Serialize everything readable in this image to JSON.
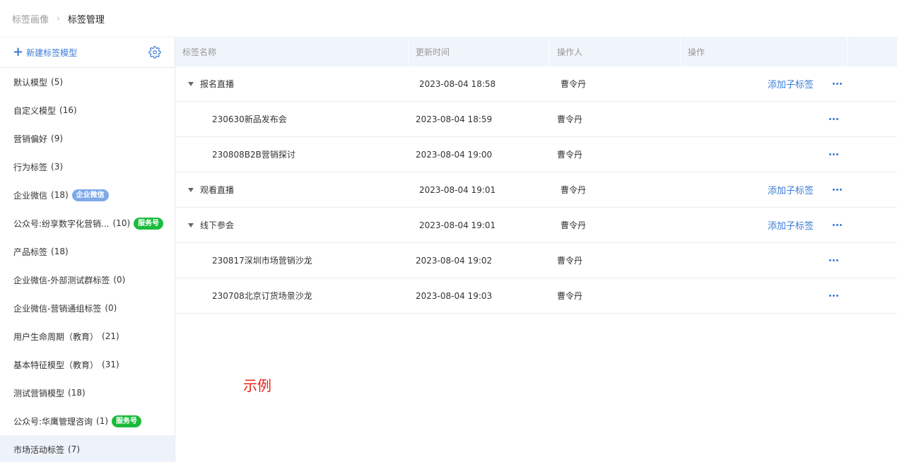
{
  "breadcrumb": {
    "parent": "标签画像",
    "separator": "›",
    "current": "标签管理"
  },
  "sidebar": {
    "new_model_label": "新建标签模型",
    "items": [
      {
        "label": "默认模型",
        "count": "(5)"
      },
      {
        "label": "自定义模型",
        "count": "(16)"
      },
      {
        "label": "营销偏好",
        "count": "(9)"
      },
      {
        "label": "行为标签",
        "count": "(3)"
      },
      {
        "label": "企业微信",
        "count": "(18)",
        "badge": "企业微信"
      },
      {
        "label": "公众号:纷享数字化营销...",
        "count": "(10)",
        "badge": "服务号"
      },
      {
        "label": "产品标签",
        "count": "(18)"
      },
      {
        "label": "企业微信-外部测试群标签",
        "count": "(0)"
      },
      {
        "label": "企业微信-营销通组标签",
        "count": "(0)"
      },
      {
        "label": "用户生命周期（教育）",
        "count": "(21)"
      },
      {
        "label": "基本特征模型（教育）",
        "count": "(31)"
      },
      {
        "label": "测试营销模型",
        "count": "(18)"
      },
      {
        "label": "公众号:华鹰管理咨询",
        "count": "(1)",
        "badge": "服务号"
      },
      {
        "label": "市场活动标签",
        "count": "(7)"
      }
    ]
  },
  "table": {
    "columns": [
      "标签名称",
      "更新时间",
      "操作人",
      "操作"
    ],
    "add_child_label": "添加子标签",
    "rows": [
      {
        "name": "报名直播",
        "time": "2023-08-04 18:58",
        "user": "曹令丹"
      },
      {
        "name": "230630新品发布会",
        "time": "2023-08-04 18:59",
        "user": "曹令丹"
      },
      {
        "name": "230808B2B营销探讨",
        "time": "2023-08-04 19:00",
        "user": "曹令丹"
      },
      {
        "name": "观看直播",
        "time": "2023-08-04 19:01",
        "user": "曹令丹"
      },
      {
        "name": "线下参会",
        "time": "2023-08-04 19:01",
        "user": "曹令丹"
      },
      {
        "name": "230817深圳市场营销沙龙",
        "time": "2023-08-04 19:02",
        "user": "曹令丹"
      },
      {
        "name": "230708北京订货场景沙龙",
        "time": "2023-08-04 19:03",
        "user": "曹令丹"
      }
    ]
  },
  "annotation": "示例",
  "colors": {
    "accent": "#3a7bd5",
    "badge_wechat": "#7ea9e8",
    "badge_service": "#1cbb3c",
    "annotation": "#e8231b",
    "header_bg": "#f0f4fb"
  },
  "icons": {
    "new_model": "plus-icon",
    "settings": "gear-icon",
    "expand": "caret-down-icon",
    "more": "more-horizontal-icon"
  }
}
